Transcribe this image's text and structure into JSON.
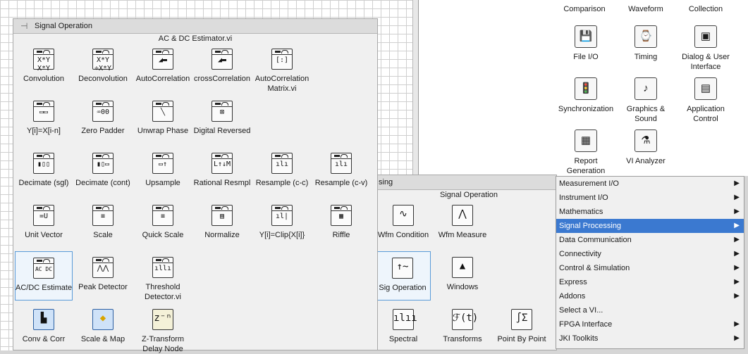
{
  "top_palette": {
    "title": "Signal Operation",
    "subtitle": "AC & DC Estimator.vi",
    "items": [
      {
        "label": "Convolution",
        "glyph": "X*Y\nX*Y"
      },
      {
        "label": "Deconvolution",
        "glyph": "X*Y\n÷X*Y"
      },
      {
        "label": "AutoCorrelation",
        "glyph": "◢▬"
      },
      {
        "label": "crossCorrelation",
        "glyph": "◢▬"
      },
      {
        "label": "AutoCorrelation",
        "label2": "Matrix.vi",
        "glyph": "[:]"
      },
      {
        "label": "Y[i]=X[i-n]",
        "glyph": "▭▭"
      },
      {
        "label": "Zero Padder",
        "glyph": "♒00"
      },
      {
        "label": "Unwrap Phase",
        "glyph": "╲"
      },
      {
        "label": "Digital Reversed",
        "glyph": "⊠"
      },
      {
        "label": "Decimate (sgl)",
        "glyph": "▮▯▯"
      },
      {
        "label": "Decimate (cont)",
        "glyph": "▮▯▭"
      },
      {
        "label": "Upsample",
        "glyph": "▭↑"
      },
      {
        "label": "Rational Resmpl",
        "glyph": "L↑↓M"
      },
      {
        "label": "Resample (c-c)",
        "glyph": "ılı"
      },
      {
        "label": "Resample (c-v)",
        "glyph": "ılı"
      },
      {
        "label": "Unit Vector",
        "glyph": "=U"
      },
      {
        "label": "Scale",
        "glyph": "≡"
      },
      {
        "label": "Quick Scale",
        "glyph": "≡"
      },
      {
        "label": "Normalize",
        "glyph": "▤"
      },
      {
        "label": "Y[i]=Clip{X[i]}",
        "glyph": "ıl|"
      },
      {
        "label": "Riffle",
        "glyph": "▦"
      },
      {
        "label": "AC/DC Estimate",
        "glyph": "AC DC"
      },
      {
        "label": "Peak Detector",
        "glyph": "⋀⋀"
      },
      {
        "label": "Threshold",
        "label2": "Detector.vi",
        "glyph": "ıllı"
      },
      {
        "label": "Conv & Corr",
        "glyph": "▙"
      },
      {
        "label": "Scale & Map",
        "glyph": "◆"
      },
      {
        "label": "Z-Transform",
        "label2": "Delay Node",
        "glyph": "z⁻ⁿ"
      }
    ]
  },
  "mid_palette": {
    "title": "sing",
    "subtitle": "Signal Operation",
    "items": [
      {
        "label": "Wfm Condition",
        "glyph": "∿"
      },
      {
        "label": "Wfm Measure",
        "glyph": "⋀"
      },
      {
        "label": "Sig Operation",
        "glyph": "↑~"
      },
      {
        "label": "Windows",
        "glyph": "▲"
      },
      {
        "label": "Spectral",
        "glyph": "ılıı"
      },
      {
        "label": "Transforms",
        "glyph": "ℱ(t)"
      },
      {
        "label": "Point By Point",
        "glyph": "∫Σ"
      }
    ]
  },
  "functions": {
    "items": [
      {
        "label": "Comparison",
        "glyph": ""
      },
      {
        "label": "Waveform",
        "glyph": ""
      },
      {
        "label": "Collection",
        "glyph": ""
      },
      {
        "label": "File I/O",
        "glyph": "💾"
      },
      {
        "label": "Timing",
        "glyph": "⌚"
      },
      {
        "label": "Dialog & User",
        "label2": "Interface",
        "glyph": "▣"
      },
      {
        "label": "Synchronization",
        "glyph": "🚦"
      },
      {
        "label": "Graphics &",
        "label2": "Sound",
        "glyph": "♪"
      },
      {
        "label": "Application",
        "label2": "Control",
        "glyph": "▤"
      },
      {
        "label": "Report",
        "label2": "Generation",
        "glyph": "▦"
      },
      {
        "label": "VI Analyzer",
        "glyph": "⚗"
      }
    ]
  },
  "menu": {
    "items": [
      {
        "label": "Measurement I/O",
        "arrow": "▶"
      },
      {
        "label": "Instrument I/O",
        "arrow": "▶"
      },
      {
        "label": "Mathematics",
        "arrow": "▶"
      },
      {
        "label": "Signal Processing",
        "arrow": "▶"
      },
      {
        "label": "Data Communication",
        "arrow": "▶"
      },
      {
        "label": "Connectivity",
        "arrow": "▶"
      },
      {
        "label": "Control & Simulation",
        "arrow": "▶"
      },
      {
        "label": "Express",
        "arrow": "▶"
      },
      {
        "label": "Addons",
        "arrow": "▶"
      },
      {
        "label": "Select a VI...",
        "arrow": ""
      },
      {
        "label": "FPGA Interface",
        "arrow": "▶"
      },
      {
        "label": "JKI Toolkits",
        "arrow": "▶"
      }
    ]
  },
  "colors": {
    "highlight": "#3b79d0",
    "selected_border": "#5a9bd8"
  }
}
